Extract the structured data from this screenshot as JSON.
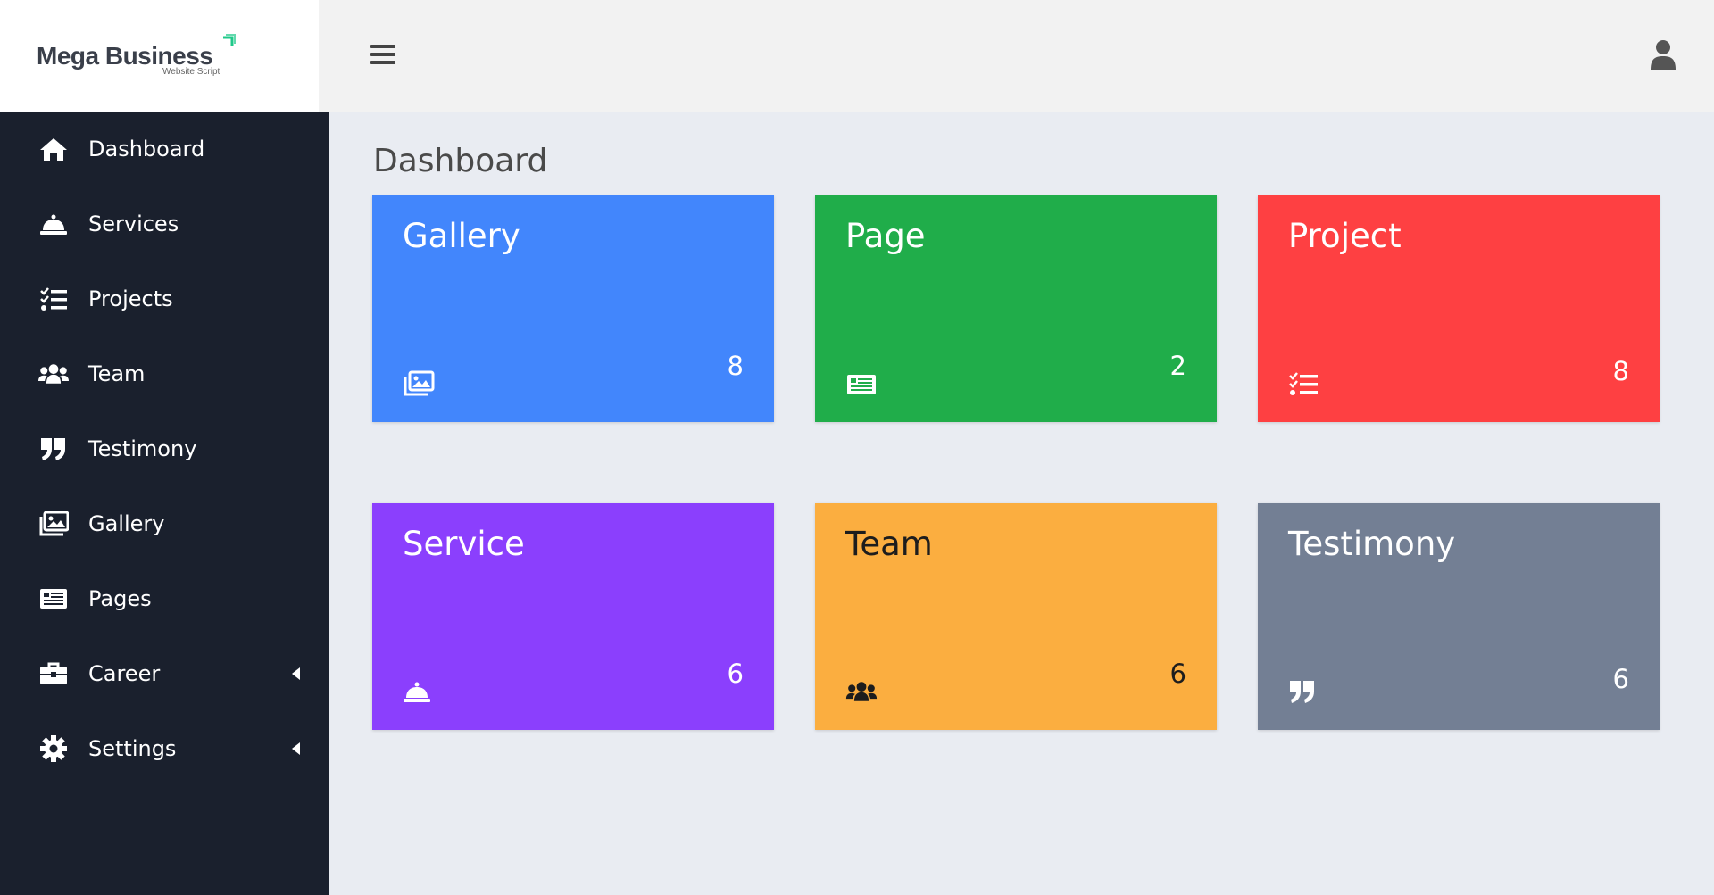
{
  "brand": {
    "name": "Mega Business",
    "tagline": "Website Script"
  },
  "topbar": {
    "menu_icon": "hamburger-icon",
    "user_icon": "user-icon"
  },
  "sidebar": {
    "items": [
      {
        "label": "Dashboard",
        "icon": "home-icon"
      },
      {
        "label": "Services",
        "icon": "bell-icon"
      },
      {
        "label": "Projects",
        "icon": "tasks-icon"
      },
      {
        "label": "Team",
        "icon": "users-icon"
      },
      {
        "label": "Testimony",
        "icon": "quote-icon"
      },
      {
        "label": "Gallery",
        "icon": "images-icon"
      },
      {
        "label": "Pages",
        "icon": "newspaper-icon"
      },
      {
        "label": "Career",
        "icon": "briefcase-icon",
        "submenu": true
      },
      {
        "label": "Settings",
        "icon": "gear-icon",
        "submenu": true
      }
    ]
  },
  "main": {
    "title": "Dashboard",
    "cards": [
      {
        "title": "Gallery",
        "count": "8",
        "color": "#4286fc",
        "icon": "images-icon"
      },
      {
        "title": "Page",
        "count": "2",
        "color": "#20ad4a",
        "icon": "newspaper-icon"
      },
      {
        "title": "Project",
        "count": "8",
        "color": "#fe4042",
        "icon": "tasks-icon"
      },
      {
        "title": "Service",
        "count": "6",
        "color": "#8b3ffd",
        "icon": "bell-icon"
      },
      {
        "title": "Team",
        "count": "6",
        "color": "#fbae40",
        "icon": "users-icon"
      },
      {
        "title": "Testimony",
        "count": "6",
        "color": "#737f94",
        "icon": "quote-icon"
      }
    ]
  }
}
